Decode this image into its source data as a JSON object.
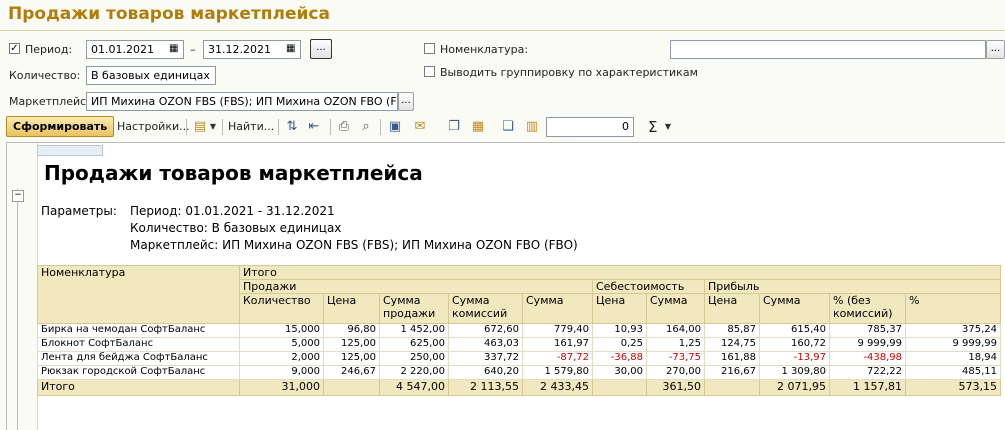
{
  "window_title": "Продажи товаров маркетплейса",
  "filters": {
    "period_label": "Период:",
    "period_checked": true,
    "date_from": "01.01.2021",
    "date_dash": "–",
    "date_to": "31.12.2021",
    "period_button": "...",
    "quantity_label": "Количество:",
    "quantity_value": "В базовых единицах",
    "marketplace_label": "Маркетплейс:",
    "marketplace_value": "ИП Михина OZON FBS (FBS); ИП Михина OZON FBO (FBO)",
    "marketplace_button": "...",
    "nomenclature_label": "Номенклатура:",
    "nomenclature_value": "",
    "nomenclature_button": "...",
    "group_by_char_label": "Выводить группировку по характеристикам"
  },
  "toolbar": {
    "generate_label": "Сформировать",
    "settings_label": "Настройки...",
    "find_label": "Найти...",
    "sum_value": "0",
    "sigma": "Σ"
  },
  "report": {
    "title": "Продажи товаров маркетплейса",
    "params_label": "Параметры:",
    "param_period": "Период: 01.01.2021 - 31.12.2021",
    "param_quantity": "Количество: В базовых единицах",
    "param_marketplace": "Маркетплейс: ИП Михина OZON FBS (FBS); ИП Михина OZON FBO (FBO)",
    "headers": {
      "nomenclature": "Номенклатура",
      "total": "Итого",
      "sales": "Продажи",
      "cost": "Себестоимость",
      "profit": "Прибыль",
      "quantity": "Количество",
      "price": "Цена",
      "sales_sum_1": "Сумма",
      "sales_sum_2": "продажи",
      "commission_sum_1": "Сумма",
      "commission_sum_2": "комиссий",
      "sum": "Сумма",
      "cost_price": "Цена",
      "cost_sum": "Сумма",
      "profit_price": "Цена",
      "profit_sum": "Сумма",
      "percent_no_comm_1": "% (без",
      "percent_no_comm_2": "комиссий)",
      "percent": "%"
    },
    "rows": [
      {
        "name": "Бирка на чемодан СофтБаланс",
        "qty": "15,000",
        "price": "96,80",
        "sales_sum": "1 452,00",
        "comm_sum": "672,60",
        "sum": "779,40",
        "cost_price": "10,93",
        "cost_sum": "164,00",
        "profit_price": "85,87",
        "profit_sum": "615,40",
        "pct_nc": "785,37",
        "pct": "375,24"
      },
      {
        "name": "Блокнот СофтБаланс",
        "qty": "5,000",
        "price": "125,00",
        "sales_sum": "625,00",
        "comm_sum": "463,03",
        "sum": "161,97",
        "cost_price": "0,25",
        "cost_sum": "1,25",
        "profit_price": "124,75",
        "profit_sum": "160,72",
        "pct_nc": "9 999,99",
        "pct": "9 999,99"
      },
      {
        "name": "Лента для бейджа СофтБаланс",
        "qty": "2,000",
        "price": "125,00",
        "sales_sum": "250,00",
        "comm_sum": "337,72",
        "sum": "-87,72",
        "cost_price": "-36,88",
        "cost_sum": "-73,75",
        "profit_price": "161,88",
        "profit_sum": "-13,97",
        "pct_nc": "-438,98",
        "pct": "18,94"
      },
      {
        "name": "Рюкзак городской СофтБаланс",
        "qty": "9,000",
        "price": "246,67",
        "sales_sum": "2 220,00",
        "comm_sum": "640,20",
        "sum": "1 579,80",
        "cost_price": "30,00",
        "cost_sum": "270,00",
        "profit_price": "216,67",
        "profit_sum": "1 309,80",
        "pct_nc": "722,22",
        "pct": "485,11"
      }
    ],
    "total": {
      "name": "Итого",
      "qty": "31,000",
      "price": "",
      "sales_sum": "4 547,00",
      "comm_sum": "2 113,55",
      "sum": "2 433,45",
      "cost_price": "",
      "cost_sum": "361,50",
      "profit_price": "",
      "profit_sum": "2 071,95",
      "pct_nc": "1 157,81",
      "pct": "573,15"
    }
  }
}
